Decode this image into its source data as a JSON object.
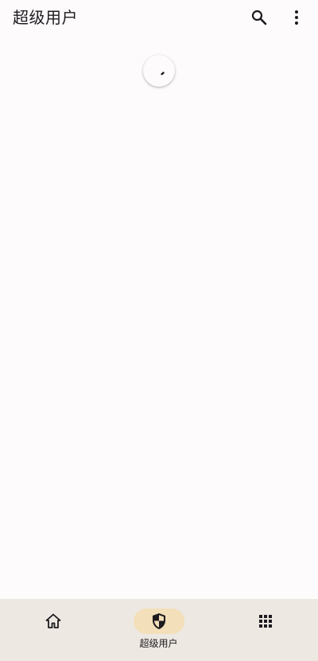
{
  "header": {
    "title": "超级用户"
  },
  "icons": {
    "search": "search-icon",
    "more": "more-vert-icon",
    "home": "home-icon",
    "superuser": "shield-icon",
    "apps": "grid-icon"
  },
  "loading": {
    "indicator": "progress-spinner"
  },
  "bottom_nav": {
    "items": [
      {
        "label": "",
        "icon": "home-icon",
        "active": false
      },
      {
        "label": "超级用户",
        "icon": "shield-icon",
        "active": true
      },
      {
        "label": "",
        "icon": "grid-icon",
        "active": false
      }
    ]
  },
  "colors": {
    "background": "#fefbfd",
    "nav_background": "#ede8e2",
    "active_indicator": "#f3dfb9",
    "text": "#1d1b1e"
  }
}
